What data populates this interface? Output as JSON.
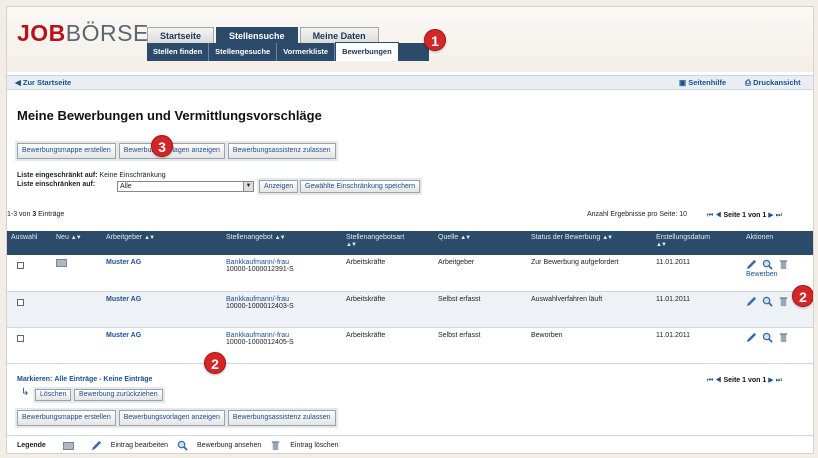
{
  "logo": {
    "job": "JOB",
    "borse": "BÖRSE"
  },
  "tabs": [
    "Startseite",
    "Stellensuche",
    "Meine Daten"
  ],
  "subnav": [
    "Stellen finden",
    "Stellengesuche",
    "Vormerkliste",
    "Bewerbungen"
  ],
  "badges": [
    "1",
    "2",
    "2",
    "3"
  ],
  "bar": {
    "back": "Zur Startseite",
    "help": "Seitenhilfe",
    "print": "Druckansicht"
  },
  "title": "Meine Bewerbungen und Vermittlungsvorschläge",
  "buttons": {
    "mappe": "Bewerbungsmappe erstellen",
    "vorlagen": "Bewerbungsvorlagen anzeigen",
    "assistent": "Bewerbungsassistenz zulassen"
  },
  "filter": {
    "label1": "Liste eingeschränkt auf:",
    "value1": "Keine Einschränkung",
    "label2": "Liste einschränken auf:",
    "select": "Alle",
    "show": "Anzeigen",
    "save": "Gewählte Einschränkung speichern"
  },
  "results": {
    "prefix": "1-3 von",
    "count": "3",
    "suffix": "Einträge",
    "per_page": "Anzahl Ergebnisse pro Seite: 10",
    "page": "Seite 1 von 1"
  },
  "columns": [
    "Auswahl",
    "Neu",
    "Arbeitgeber",
    "Stellenangebot",
    "Stellenangebotsart",
    "Quelle",
    "Status der Bewerbung",
    "Erstellungsdatum",
    "Aktionen"
  ],
  "rows": [
    {
      "employer": "Muster AG",
      "offer": "Bankkaufmann/-frau",
      "offer_id": "10000-1000012391-S",
      "type": "Arbeitskräfte",
      "source": "Arbeitgeber",
      "status": "Zur Bewerbung aufgefordert",
      "date": "11.01.2011",
      "apply": "Bewerben"
    },
    {
      "employer": "Muster AG",
      "offer": "Bankkaufmann/-frau",
      "offer_id": "10000-1000012403-S",
      "type": "Arbeitskräfte",
      "source": "Selbst erfasst",
      "status": "Auswahlverfahren läuft",
      "date": "11.01.2011"
    },
    {
      "employer": "Muster AG",
      "offer": "Bankkaufmann/-frau",
      "offer_id": "10000-1000012405-S",
      "type": "Arbeitskräfte",
      "source": "Selbst erfasst",
      "status": "Beworben",
      "date": "11.01.2011"
    }
  ],
  "mark": {
    "label": "Markieren:",
    "all": "Alle Einträge",
    "sep": "-",
    "none": "Keine Einträge"
  },
  "actions": {
    "delete": "Löschen",
    "withdraw": "Bewerbung zurückziehen"
  },
  "legend": {
    "title": "Legende",
    "edit": "Eintrag bearbeiten",
    "view": "Bewerbung ansehen",
    "delete": "Eintrag löschen"
  },
  "colors": {
    "navy": "#2c4a6a",
    "red": "#d32727",
    "link": "#1c4f8e"
  }
}
